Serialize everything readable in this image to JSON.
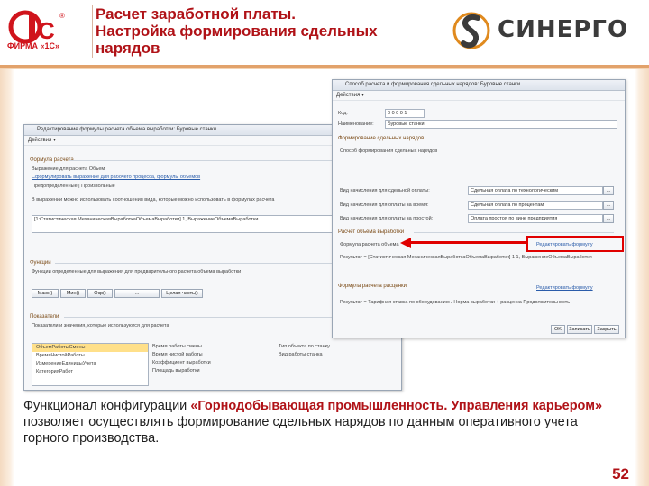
{
  "header": {
    "title_lines": [
      "Расчет заработной платы.",
      "Настройка формирования сдельных",
      "нарядов"
    ],
    "logo_left_text": "1С",
    "logo_left_sub": "ФИРМА «1С»",
    "logo_right_text": "СИНЕРГО"
  },
  "left_window": {
    "title": "Редактирование формулы расчета объема выработки: Буровые станки",
    "toolbar": "Действия ▾",
    "section_formula": "Формула расчета",
    "line1": "Выражение для расчета Объем",
    "line2": "Сформулировать выражение для рабочего процесса, формулы объемов",
    "line3": "Предопределенные | Произвольные",
    "line4": "В выражении можно использовать соотношения вида, которые можно использовать в формулах расчета",
    "formula": "[1:Статистическая МеханическаяВыработкаОбъемаВыработки] 1, ВыражениеОбъемаВыработки",
    "section_func": "Функции",
    "func_desc": "Функции определенные для выражения для предварительного расчета объема выработки",
    "buttons": [
      "Макс()",
      "Мин()",
      "Окр()",
      "...",
      "Целая часть()"
    ],
    "section_indicators": "Показатели",
    "ind_desc": "Показатели и значения, которые используются для расчета",
    "list_items": [
      "ОбъемРаботыСмены",
      "ВремяЧистойРаботы",
      "ИзмерениеЕдиницыУчета",
      "КатегорияРабот"
    ],
    "list_items2": [
      "Время работы смены",
      "Время чистой работы",
      "Коэффициент выработки",
      "Площадь выработки"
    ],
    "list_items3": [
      "Тип объекта по станку",
      "Вид работы станка"
    ]
  },
  "right_window": {
    "title": "Способ расчета и формирования сдельных нарядов: Буровые станки",
    "toolbar": "Действия ▾",
    "name_label": "Код:",
    "name_value": "0 0 0 0 1",
    "name2_label": "Наименование:",
    "name2_value": "Буровые станки",
    "section1": "Формирование сдельных нарядов",
    "sub1": "Способ формирования сдельных нарядов",
    "row1_label": "Вид начисления для сдельной оплаты:",
    "row1_value": "Сдельная оплата по технологическим",
    "row2_label": "Вид начисления для оплаты за время:",
    "row2_value": "Сдельная оплата по процентам",
    "row3_label": "Вид начисления для оплаты за простой:",
    "row3_value": "Оплата простоя по вине предприятия",
    "section2": "Расчет объема выработки",
    "sub2": "Формула расчета объема",
    "edit_link": "Редактировать формулу",
    "result1": "Результат = [Статистическая МеханическаяВыработкаОбъемаВыработки] 1 1, ВыражениеОбъемаВыработки",
    "section3": "Формула расчета расценки",
    "edit_link2": "Редактировать формулу",
    "result2": "Результат = Тарифная ставка по оборудованию / Норма выработки + расценка Продолжительность",
    "ok": "OK",
    "save": "Записать",
    "close": "Закрыть"
  },
  "caption": {
    "part1": "Функционал конфигурации ",
    "highlight": "«Горнодобывающая промышленность. Управления карьером»",
    "part2": " позволяет осуществлять формирование сдельных нарядов по данным оперативного учета горного производства."
  },
  "page_number": "52",
  "colors": {
    "accent_red": "#b01217",
    "arrow_red": "#e00000",
    "orange_bar": "#e2a26b"
  }
}
